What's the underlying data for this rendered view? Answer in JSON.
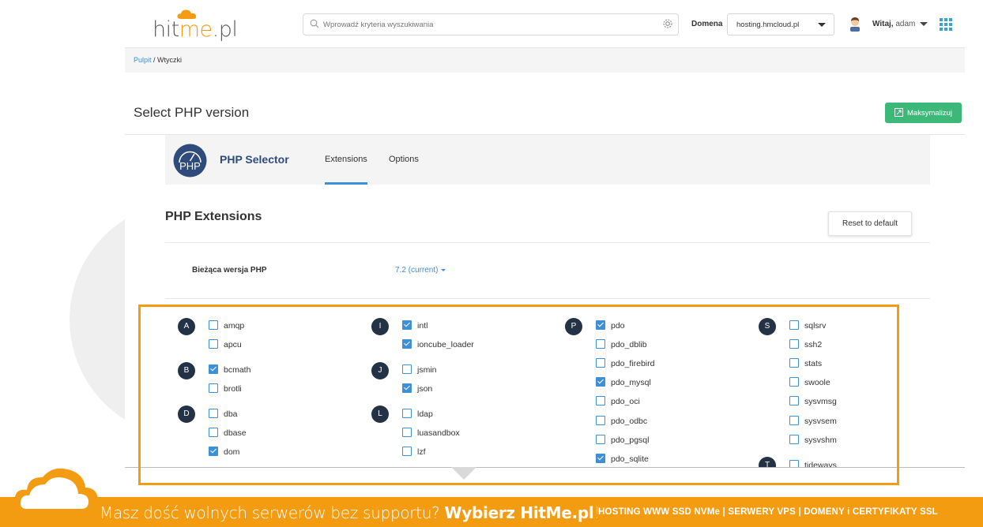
{
  "brand": {
    "logo_prefix": "hit",
    "logo_me": "me",
    "logo_suffix": ".pl",
    "accent_color": "#f39c12"
  },
  "header": {
    "search_placeholder": "Wprowadź kryteria wyszukiwania",
    "domain_label": "Domena",
    "domain_value": "hosting.hmcloud.pl",
    "welcome_bold": "Witaj,",
    "welcome_user": "adam"
  },
  "breadcrumb": {
    "home": "Pulpit",
    "separator": " / ",
    "current": "Wtyczki"
  },
  "page": {
    "title": "Select PHP version",
    "maximize_label": "Maksymalizuj"
  },
  "selector": {
    "logo_text": "PHP",
    "title": "PHP Selector",
    "tabs": [
      "Extensions",
      "Options"
    ],
    "active_tab": "Extensions"
  },
  "extensions": {
    "title": "PHP Extensions",
    "reset_label": "Reset to default",
    "version_label": "Bieżąca wersja PHP",
    "version_value": "7.2 (current)",
    "groups": [
      {
        "letter": "A",
        "items": [
          {
            "name": "amqp",
            "checked": false
          },
          {
            "name": "apcu",
            "checked": false
          }
        ]
      },
      {
        "letter": "B",
        "items": [
          {
            "name": "bcmath",
            "checked": true
          },
          {
            "name": "brotli",
            "checked": false
          }
        ]
      },
      {
        "letter": "D",
        "items": [
          {
            "name": "dba",
            "checked": false
          },
          {
            "name": "dbase",
            "checked": false
          },
          {
            "name": "dom",
            "checked": true
          }
        ]
      },
      {
        "letter": "I",
        "items": [
          {
            "name": "intl",
            "checked": true
          },
          {
            "name": "ioncube_loader",
            "checked": true
          }
        ]
      },
      {
        "letter": "J",
        "items": [
          {
            "name": "jsmin",
            "checked": false
          },
          {
            "name": "json",
            "checked": true
          }
        ]
      },
      {
        "letter": "L",
        "items": [
          {
            "name": "ldap",
            "checked": false
          },
          {
            "name": "luasandbox",
            "checked": false
          },
          {
            "name": "lzf",
            "checked": false
          }
        ]
      },
      {
        "letter": "P",
        "items": [
          {
            "name": "pdo",
            "checked": true
          },
          {
            "name": "pdo_dblib",
            "checked": false
          },
          {
            "name": "pdo_firebird",
            "checked": false
          },
          {
            "name": "pdo_mysql",
            "checked": true
          },
          {
            "name": "pdo_oci",
            "checked": false
          },
          {
            "name": "pdo_odbc",
            "checked": false
          },
          {
            "name": "pdo_pgsql",
            "checked": false
          },
          {
            "name": "pdo_sqlite",
            "checked": true
          }
        ]
      },
      {
        "letter": "S",
        "items": [
          {
            "name": "sqlsrv",
            "checked": false
          },
          {
            "name": "ssh2",
            "checked": false
          },
          {
            "name": "stats",
            "checked": false
          },
          {
            "name": "swoole",
            "checked": false
          },
          {
            "name": "sysvmsg",
            "checked": false
          },
          {
            "name": "sysvsem",
            "checked": false
          },
          {
            "name": "sysvshm",
            "checked": false
          }
        ]
      },
      {
        "letter": "T",
        "items": [
          {
            "name": "tideways",
            "checked": false
          }
        ]
      }
    ]
  },
  "banner": {
    "main_text": "Masz dość wolnych serwerów bez supportu? ",
    "cta": "Wybierz HitMe.pl",
    "cta_suffix": "!",
    "right_text": "HOSTING WWW SSD NVMe | SERWERY VPS | DOMENY i CERTYFIKATY SSL"
  }
}
